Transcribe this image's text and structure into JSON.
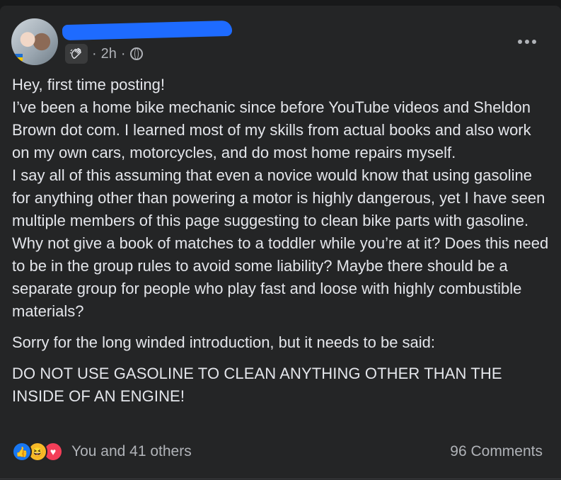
{
  "post": {
    "time": "2h",
    "time_separator": "·",
    "body": {
      "p1": "Hey, first time posting!",
      "p2": "I’ve been a home bike mechanic since before YouTube videos and Sheldon Brown dot com. I learned most of my skills from actual books and also work on my own cars, motorcycles, and do most home repairs myself.",
      "p3": "I say all of this assuming that even a novice would know that using gasoline for anything other than powering a motor is highly dangerous, yet I have seen multiple members of this page suggesting to clean bike parts with gasoline. Why not give a book of matches to a toddler while you’re at it? Does this need to be in the group rules to avoid some liability? Maybe there should be a separate group for people who play fast and loose with highly combustible materials?",
      "p4": "Sorry for the long winded introduction, but it needs to be said:",
      "p5": "DO NOT USE GASOLINE TO CLEAN ANYTHING OTHER THAN THE INSIDE OF AN ENGINE!"
    },
    "reactions": {
      "icons": [
        "like-icon",
        "haha-icon",
        "love-icon"
      ],
      "summary": "You and 41 others"
    },
    "comments": "96 Comments"
  },
  "colors": {
    "card": "#242526",
    "text": "#e4e6eb",
    "secondary": "#b0b3b8",
    "redaction": "#1e6bff",
    "like": "#1877f2",
    "haha": "#f7b928",
    "love": "#f33e58"
  }
}
